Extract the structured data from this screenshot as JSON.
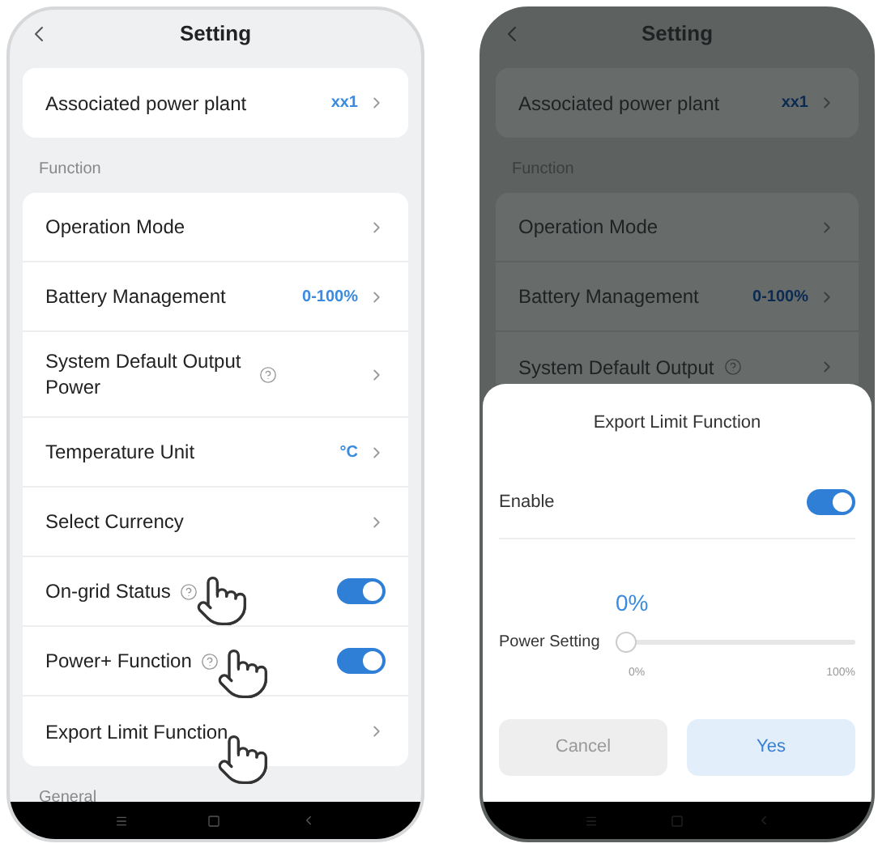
{
  "phones": [
    {
      "title": "Setting",
      "dimmed": false,
      "sections": [
        {
          "items": [
            {
              "kind": "link",
              "label": "Associated power plant",
              "value": "xx1"
            }
          ]
        },
        {
          "heading": "Function",
          "items": [
            {
              "kind": "link",
              "label": "Operation Mode"
            },
            {
              "kind": "link",
              "label": "Battery Management",
              "value": "0-100%"
            },
            {
              "kind": "link",
              "label": "System Default Output Power",
              "help": true
            },
            {
              "kind": "link",
              "label": "Temperature Unit",
              "value": "°C"
            },
            {
              "kind": "link",
              "label": "Select Currency"
            },
            {
              "kind": "toggle",
              "label": "On-grid Status",
              "help": true,
              "on": true
            },
            {
              "kind": "toggle",
              "label": "Power+ Function",
              "help": true,
              "on": true
            },
            {
              "kind": "link",
              "label": "Export Limit Function"
            }
          ]
        },
        {
          "heading": "General"
        }
      ]
    },
    {
      "title": "Setting",
      "dimmed": true,
      "sections": [
        {
          "items": [
            {
              "kind": "link",
              "label": "Associated power plant",
              "value": "xx1"
            }
          ]
        },
        {
          "heading": "Function",
          "items": [
            {
              "kind": "link",
              "label": "Operation Mode"
            },
            {
              "kind": "link",
              "label": "Battery Management",
              "value": "0-100%"
            },
            {
              "kind": "link",
              "label": "System Default Output",
              "help": true
            }
          ]
        }
      ],
      "sheet": {
        "title": "Export Limit Function",
        "enable": {
          "label": "Enable",
          "on": true
        },
        "power": {
          "reading": "0%",
          "label": "Power Setting",
          "level": 0,
          "min_label": "0%",
          "max_label": "100%"
        },
        "buttons": [
          {
            "label": "Cancel",
            "kind": "secondary"
          },
          {
            "label": "Yes",
            "kind": "primary"
          }
        ]
      }
    }
  ]
}
